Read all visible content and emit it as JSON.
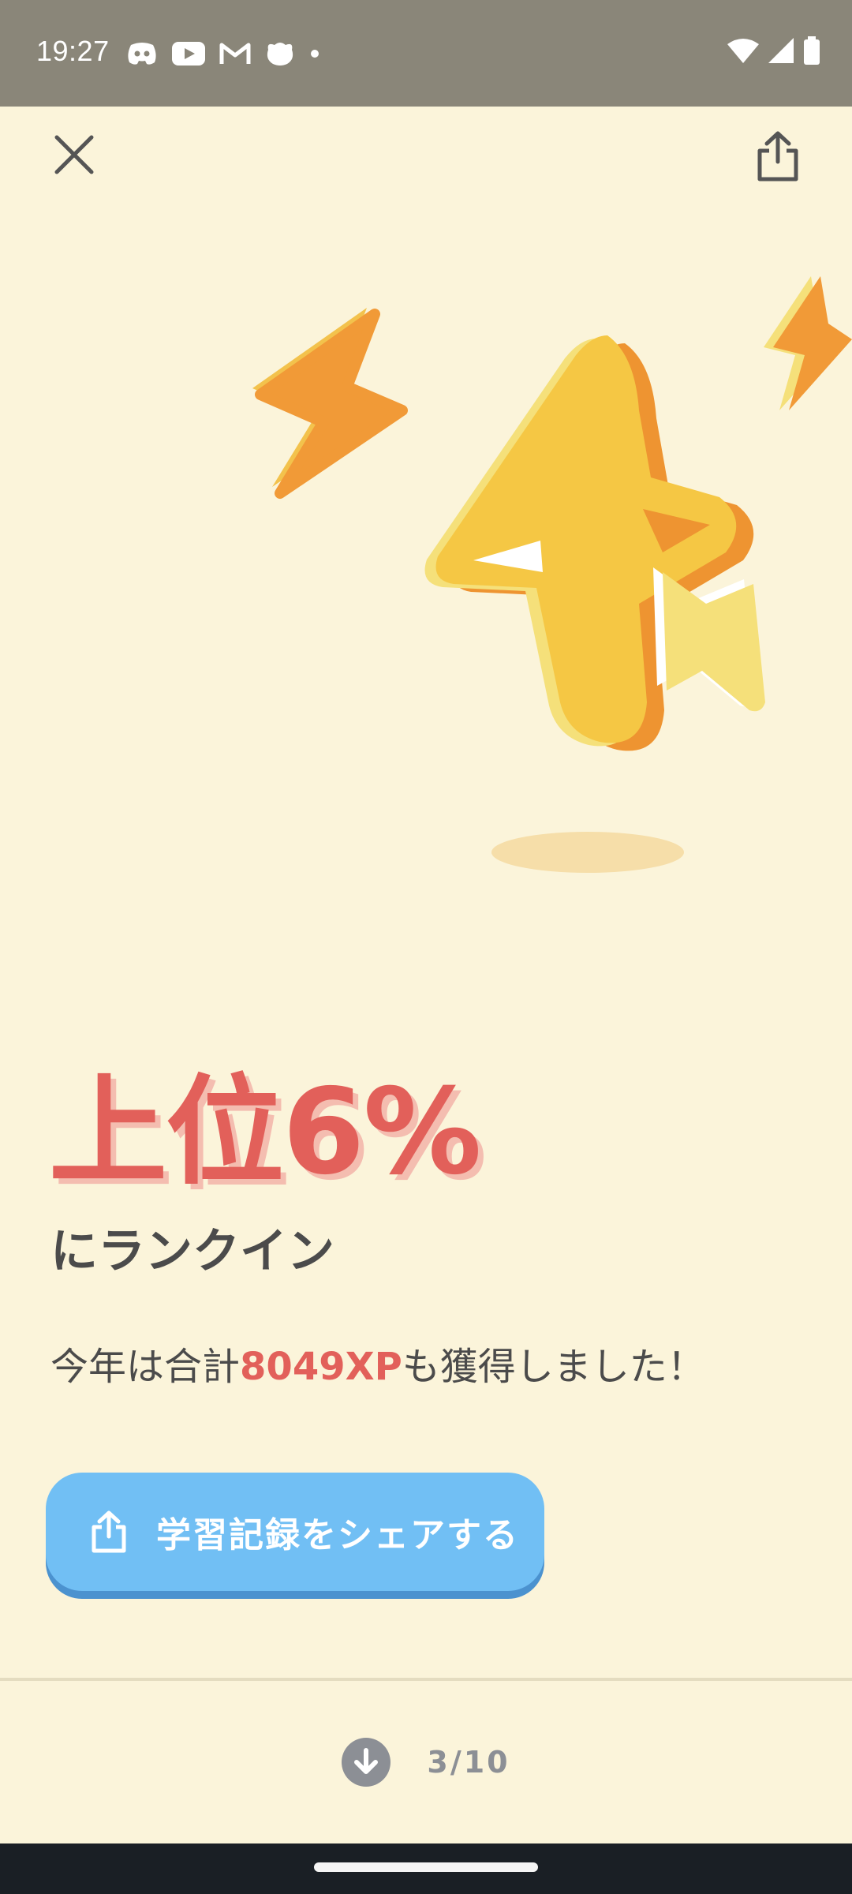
{
  "status_bar": {
    "time": "19:27",
    "left_icons": [
      "discord-icon",
      "youtube-icon",
      "gmail-icon",
      "duolingo-icon",
      "dot-icon"
    ],
    "right_icons": [
      "wifi-icon",
      "signal-icon",
      "battery-icon"
    ]
  },
  "header": {
    "close_icon": "close-icon",
    "share_icon": "share-icon"
  },
  "result": {
    "headline": "上位6%",
    "subheadline": "にランクイン",
    "summary_prefix": "今年は合計",
    "xp_value": "8049XP",
    "summary_suffix": "も獲得しました！"
  },
  "share_button": {
    "label": "学習記録をシェアする",
    "icon": "share-icon"
  },
  "pager": {
    "icon": "arrow-down-icon",
    "label": "3/10"
  },
  "colors": {
    "background": "#FBF4DA",
    "accent_red": "#E2605A",
    "button_blue": "#71BFF4",
    "status_bar": "#8A8679"
  }
}
